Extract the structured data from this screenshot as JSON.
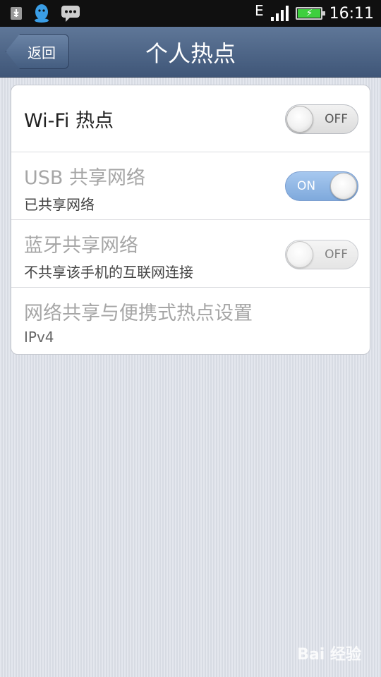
{
  "status_bar": {
    "network_type": "E",
    "time": "16:11",
    "left_icons": [
      "usb-icon",
      "qq-icon",
      "message-icon"
    ],
    "battery_charging": true
  },
  "title_bar": {
    "back_label": "返回",
    "title": "个人热点"
  },
  "settings": {
    "wifi_hotspot": {
      "title": "Wi-Fi 热点",
      "toggle": "OFF"
    },
    "usb_tethering": {
      "title": "USB 共享网络",
      "subtitle": "已共享网络",
      "toggle": "ON"
    },
    "bluetooth_tethering": {
      "title": "蓝牙共享网络",
      "subtitle": "不共享该手机的互联网连接",
      "toggle": "OFF"
    },
    "tethering_settings": {
      "title": "网络共享与便携式热点设置",
      "subtitle": "IPv4"
    }
  },
  "watermark": "Bai 经验",
  "colors": {
    "titlebar": "#4d6587",
    "toggle_on": "#8fb5e6",
    "background": "#dee1e8"
  }
}
